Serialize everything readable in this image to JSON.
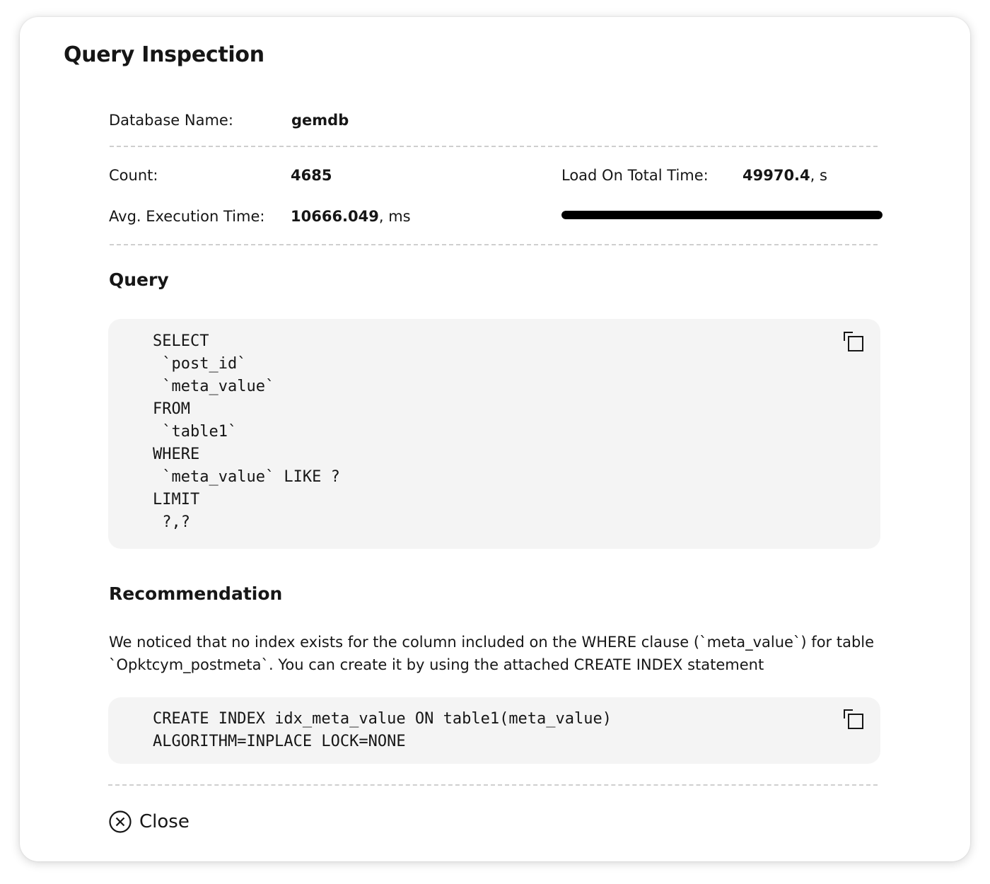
{
  "dialog": {
    "title": "Query Inspection"
  },
  "details": {
    "database_name_label": "Database Name:",
    "database_name_value": "gemdb",
    "count_label": "Count:",
    "count_value": "4685",
    "avg_exec_label": "Avg. Execution Time:",
    "avg_exec_value": "10666.049",
    "avg_exec_unit": ", ms",
    "load_label": "Load On Total Time:",
    "load_value": "49970.4",
    "load_unit": ", s",
    "load_bar_fraction": 1.0
  },
  "query": {
    "heading": "Query",
    "text": "SELECT\n `post_id`\n `meta_value`\nFROM\n `table1`\nWHERE\n `meta_value` LIKE ?\nLIMIT\n ?,?",
    "copy_icon": "copy-icon"
  },
  "recommendation": {
    "heading": "Recommendation",
    "description": "We noticed that no index exists for the column included on the WHERE clause (`meta_value`) for table `Opktcym_postmeta`. You can create it by using the attached CREATE INDEX statement",
    "statement": "CREATE INDEX idx_meta_value ON table1(meta_value)\nALGORITHM=INPLACE LOCK=NONE",
    "copy_icon": "copy-icon"
  },
  "footer": {
    "close_label": "Close",
    "close_icon": "close-circle-icon"
  },
  "colors": {
    "text": "#161616",
    "code_background": "#f4f4f4",
    "load_bar_fill": "#000000",
    "divider": "#cfcfcf"
  }
}
